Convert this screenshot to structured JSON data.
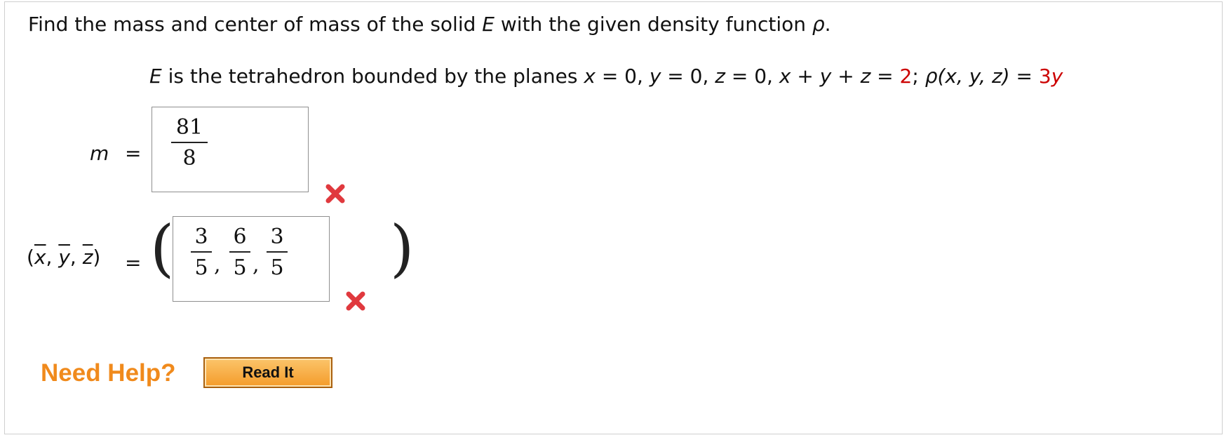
{
  "problem": {
    "prefix": "Find the mass and center of mass of the solid ",
    "solid": "E",
    "middle": " with the given density function ",
    "rho": "ρ",
    "end": "."
  },
  "given": {
    "solid": "E",
    "text": " is the tetrahedron bounded by the planes ",
    "x": "x",
    "eq1": " = 0, ",
    "y": "y",
    "eq2": " = 0, ",
    "z": "z",
    "eq3": " = 0, ",
    "plane_lhs_x": "x",
    "plus1": " + ",
    "plane_lhs_y": "y",
    "plus2": " + ",
    "plane_lhs_z": "z",
    "eq4": " = ",
    "plane_value": "2",
    "semicolon": "; ",
    "rho_expr": "ρ(x, y, z)",
    "eq5": " = ",
    "density_coef": "3",
    "density_var": "y"
  },
  "mass": {
    "label": "m",
    "equals": "=",
    "answer_num": "81",
    "answer_den": "8",
    "status": "incorrect"
  },
  "center": {
    "label_open": "(",
    "x": "x",
    "y": "y",
    "z": "z",
    "sep": ", ",
    "label_close": ")",
    "equals": "=",
    "open_paren": "(",
    "close_paren": ")",
    "fractions": [
      {
        "num": "3",
        "den": "5"
      },
      {
        "num": "6",
        "den": "5"
      },
      {
        "num": "3",
        "den": "5"
      }
    ],
    "comma": ",",
    "status": "incorrect"
  },
  "help": {
    "label": "Need Help?",
    "button": "Read It"
  },
  "colors": {
    "accent_red": "#cc0000",
    "help_orange": "#f08a1c",
    "incorrect_mark": "#e0393e"
  }
}
